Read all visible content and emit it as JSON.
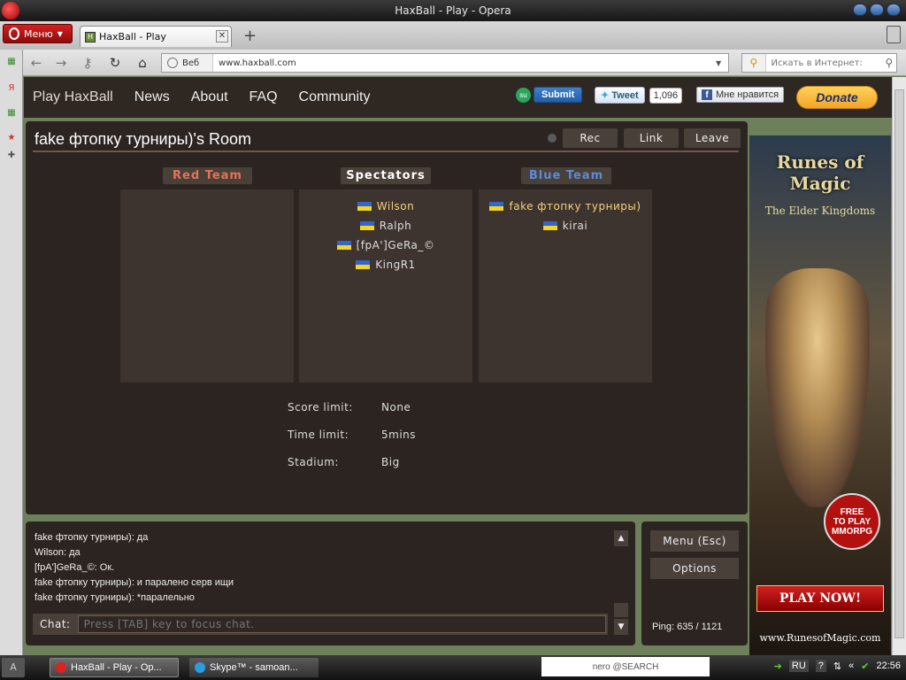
{
  "window": {
    "title": "HaxBall - Play - Opera"
  },
  "browser": {
    "menu_label": "Меню",
    "tab_title": "HaxBall - Play",
    "tab_close": "✕",
    "new_tab": "+",
    "address_prefix": "Веб",
    "url": "www.haxball.com",
    "search_placeholder": "Искать в Интернет:"
  },
  "site_nav": {
    "items": [
      "Play HaxBall",
      "News",
      "About",
      "FAQ",
      "Community"
    ]
  },
  "social": {
    "submit": "Submit",
    "stumble_icon": "su",
    "tweet": "Tweet",
    "tweet_count": "1,096",
    "like": "Мне нравится",
    "fb_icon": "f",
    "donate": "Donate"
  },
  "room": {
    "title": "fake фтопку турниры)'s Room",
    "buttons": {
      "rec": "Rec",
      "link": "Link",
      "leave": "Leave"
    },
    "teams": {
      "red": {
        "label": "Red Team",
        "players": []
      },
      "spectators": {
        "label": "Spectators",
        "players": [
          "Wilson",
          "Ralph",
          "[fpA']GeRa_©",
          "KingR1"
        ]
      },
      "blue": {
        "label": "Blue Team",
        "players": [
          "fake фтопку турниры)",
          "kirai"
        ]
      }
    },
    "settings": {
      "score_limit_label": "Score limit:",
      "score_limit": "None",
      "time_limit_label": "Time limit:",
      "time_limit": "5mins",
      "stadium_label": "Stadium:",
      "stadium": "Big"
    }
  },
  "chat": {
    "messages": [
      "fake фтопку турниры): да",
      "Wilson: да",
      "[fpA']GeRa_©: Ок.",
      "fake фтопку турниры): и паралено серв ищи",
      "fake фтопку турниры): *паралельно"
    ],
    "label": "Chat:",
    "placeholder": "Press [TAB] key to focus chat.",
    "scroll_up": "▲",
    "scroll_down": "▼"
  },
  "side": {
    "menu": "Menu (Esc)",
    "options": "Options",
    "ping": "Ping: 635 / 1121"
  },
  "ad": {
    "title": "Runes of Magic",
    "subtitle": "The Elder Kingdoms",
    "badge_line1": "FREE",
    "badge_line2": "TO PLAY",
    "badge_line3": "MMORPG",
    "cta": "PLAY NOW!",
    "url": "www.RunesofMagic.com"
  },
  "taskbar": {
    "start": "A",
    "tasks": [
      "HaxBall - Play - Op...",
      "Skype™ - samoan..."
    ],
    "nero": "nero @SEARCH",
    "lang": "RU",
    "help": "?",
    "time": "22:56"
  },
  "colors": {
    "red_team": "#e2735a",
    "blue_team": "#5b8bd8",
    "spectators": "#ffffff",
    "player_highlight": "#f3d27a"
  }
}
